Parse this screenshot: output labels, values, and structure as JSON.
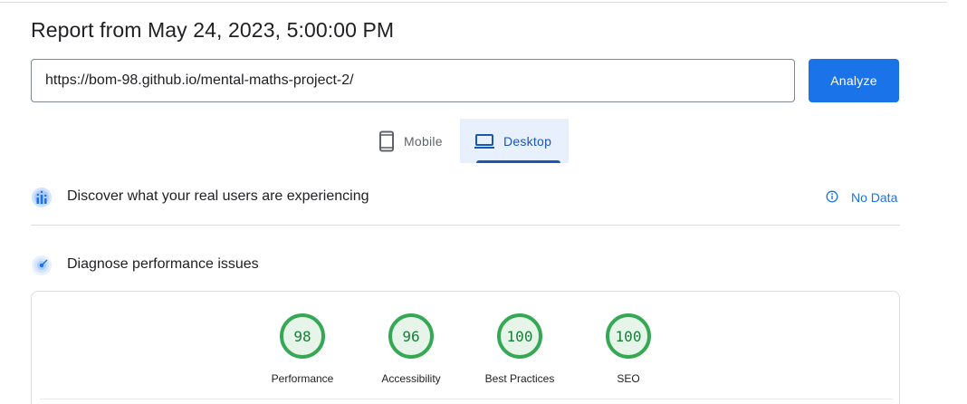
{
  "report": {
    "title": "Report from May 24, 2023, 5:00:00 PM"
  },
  "search": {
    "url_value": "https://bom-98.github.io/mental-maths-project-2/",
    "analyze_label": "Analyze"
  },
  "device_tabs": {
    "mobile_label": "Mobile",
    "desktop_label": "Desktop",
    "selected": "Desktop"
  },
  "field_data": {
    "title": "Discover what your real users are experiencing",
    "status_label": "No Data",
    "status_icon": "info-icon"
  },
  "lab_data": {
    "title": "Diagnose performance issues",
    "scores": [
      {
        "value": "98",
        "label": "Performance"
      },
      {
        "value": "96",
        "label": "Accessibility"
      },
      {
        "value": "100",
        "label": "Best Practices"
      },
      {
        "value": "100",
        "label": "SEO"
      }
    ]
  },
  "colors": {
    "accent": "#1a73e8",
    "selected_tab_text": "#1a56b6",
    "selected_tab_bg": "#e8f0fe",
    "score_good": "#34a853",
    "score_good_fill": "#e6f4ea",
    "score_good_text": "#188038"
  }
}
